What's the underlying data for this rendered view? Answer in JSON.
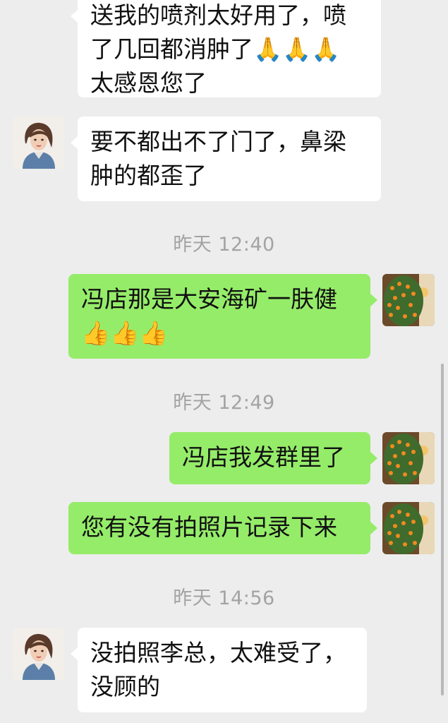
{
  "messages": [
    {
      "side": "in",
      "lines": [
        "送我的喷剂太好用了，喷",
        "了几回都消肿了🙏🙏🙏",
        "太感恩您了"
      ]
    },
    {
      "side": "in",
      "lines": [
        "要不都出不了门了，鼻梁",
        "肿的都歪了"
      ]
    },
    {
      "side": "out",
      "lines": [
        "冯店那是大安海矿一肤健",
        "👍👍👍"
      ]
    },
    {
      "side": "out",
      "lines": [
        "冯店我发群里了"
      ]
    },
    {
      "side": "out",
      "lines": [
        "您有没有拍照片记录下来"
      ]
    },
    {
      "side": "in",
      "lines": [
        "没拍照李总，太难受了，",
        "没顾的"
      ]
    }
  ],
  "timestamps": [
    "昨天 12:40",
    "昨天 12:49",
    "昨天 14:56"
  ],
  "icons": {
    "contact_avatar": "woman-portrait-avatar",
    "my_avatar": "orange-tree-avatar"
  },
  "colors": {
    "background": "#ededed",
    "incoming_bubble": "#ffffff",
    "outgoing_bubble": "#95ec69",
    "timestamp": "#a3a3a3"
  }
}
